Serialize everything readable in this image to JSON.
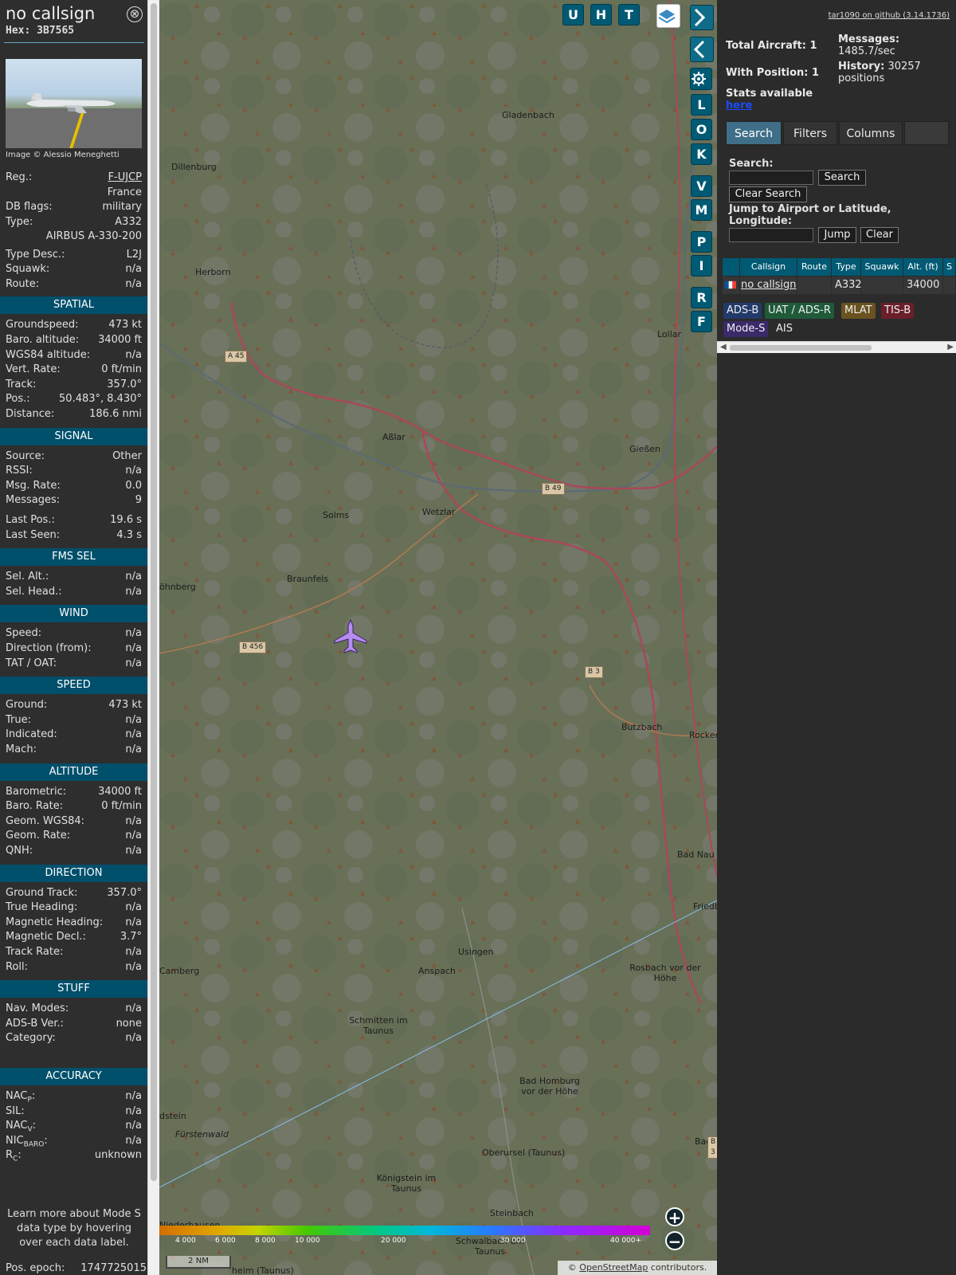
{
  "sidebar": {
    "callsign": "no callsign",
    "hex_label": "Hex:",
    "hex": "3B7565",
    "close_glyph": "⊗",
    "photo_credit": "Image © Alessio Meneghetti",
    "top_rows": [
      {
        "key": "Reg.:",
        "value": "F-UJCP"
      },
      {
        "key": "",
        "value": "France"
      },
      {
        "key": "DB flags:",
        "value": "military"
      },
      {
        "key": "Type:",
        "value": "A332"
      },
      {
        "key": "",
        "value": "AIRBUS A-330-200"
      },
      {
        "key": "Type Desc.:",
        "value": "L2J"
      },
      {
        "key": "Squawk:",
        "value": "n/a"
      },
      {
        "key": "Route:",
        "value": "n/a"
      }
    ],
    "sections": {
      "spatial": {
        "title": "SPATIAL",
        "rows": [
          {
            "key": "Groundspeed:",
            "value": "473 kt"
          },
          {
            "key": "Baro. altitude:",
            "value": "34000 ft"
          },
          {
            "key": "WGS84 altitude:",
            "value": "n/a"
          },
          {
            "key": "Vert. Rate:",
            "value": "0 ft/min"
          },
          {
            "key": "Track:",
            "value": "357.0°"
          },
          {
            "key": "Pos.:",
            "value": "50.483°, 8.430°"
          },
          {
            "key": "Distance:",
            "value": "186.6 nmi"
          }
        ]
      },
      "signal": {
        "title": "SIGNAL",
        "rows": [
          {
            "key": "Source:",
            "value": "Other"
          },
          {
            "key": "RSSI:",
            "value": "n/a"
          },
          {
            "key": "Msg. Rate:",
            "value": "0.0"
          },
          {
            "key": "Messages:",
            "value": "9"
          },
          {
            "key": "Last Pos.:",
            "value": "19.6 s"
          },
          {
            "key": "Last Seen:",
            "value": "4.3 s"
          }
        ]
      },
      "fms": {
        "title": "FMS SEL",
        "rows": [
          {
            "key": "Sel. Alt.:",
            "value": "n/a"
          },
          {
            "key": "Sel. Head.:",
            "value": "n/a"
          }
        ]
      },
      "wind": {
        "title": "WIND",
        "rows": [
          {
            "key": "Speed:",
            "value": "n/a"
          },
          {
            "key": "Direction (from):",
            "value": "n/a"
          },
          {
            "key": "TAT / OAT:",
            "value": "n/a"
          }
        ]
      },
      "speed": {
        "title": "SPEED",
        "rows": [
          {
            "key": "Ground:",
            "value": "473 kt"
          },
          {
            "key": "True:",
            "value": "n/a"
          },
          {
            "key": "Indicated:",
            "value": "n/a"
          },
          {
            "key": "Mach:",
            "value": "n/a"
          }
        ]
      },
      "altitude": {
        "title": "ALTITUDE",
        "rows": [
          {
            "key": "Barometric:",
            "value": "34000 ft"
          },
          {
            "key": "Baro. Rate:",
            "value": "0 ft/min"
          },
          {
            "key": "Geom. WGS84:",
            "value": "n/a"
          },
          {
            "key": "Geom. Rate:",
            "value": "n/a"
          },
          {
            "key": "QNH:",
            "value": "n/a"
          }
        ]
      },
      "direction": {
        "title": "DIRECTION",
        "rows": [
          {
            "key": "Ground Track:",
            "value": "357.0°"
          },
          {
            "key": "True Heading:",
            "value": "n/a"
          },
          {
            "key": "Magnetic Heading:",
            "value": "n/a"
          },
          {
            "key": "Magnetic Decl.:",
            "value": "3.7°"
          },
          {
            "key": "Track Rate:",
            "value": "n/a"
          },
          {
            "key": "Roll:",
            "value": "n/a"
          }
        ]
      },
      "stuff": {
        "title": "STUFF",
        "rows": [
          {
            "key": "Nav. Modes:",
            "value": "n/a"
          },
          {
            "key": "ADS-B Ver.:",
            "value": "none"
          },
          {
            "key": "Category:",
            "value": "n/a"
          }
        ]
      },
      "accuracy": {
        "title": "ACCURACY",
        "rows": [
          {
            "key": "NAC",
            "sub": "P",
            "value": "n/a"
          },
          {
            "key": "SIL:",
            "sub": "",
            "value": "n/a"
          },
          {
            "key": "NAC",
            "sub": "V",
            "value": "n/a"
          },
          {
            "key": "NIC",
            "sub": "BARO",
            "value": "n/a"
          },
          {
            "key": "R",
            "sub": "C",
            "value": "unknown"
          }
        ]
      }
    },
    "learn_more": "Learn more about Mode S data type by hovering over each data label.",
    "pos_epoch_label": "Pos. epoch:",
    "pos_epoch": "1747725015"
  },
  "map": {
    "toolbar_top": [
      "U",
      "H",
      "T"
    ],
    "side_buttons": [
      "L",
      "O",
      "K",
      "V",
      "M",
      "P",
      "I",
      "R",
      "F"
    ],
    "places": [
      "Gladenbach",
      "Dillenburg",
      "Herborn",
      "Aßlar",
      "Gießen",
      "Solms",
      "Wetzlar",
      "Braunfels",
      "öhnberg",
      "Lollar",
      "Butzbach",
      "Rockenb",
      "Bad Nau",
      "Friedb",
      "Usingen",
      "Camberg",
      "Anspach",
      "Rosbach vor der Höhe",
      "Schmitten im Taunus",
      "Bad Homburg vor der Höhe",
      "dstein",
      "Fürstenwald",
      "Oberursel (Taunus)",
      "Königstein im Taunus",
      "Steinbach",
      "Niederhausen",
      "Schwalbach am Taunus",
      "heim (Taunus)",
      "Bad"
    ],
    "roads": [
      "A 45",
      "B 49",
      "B 456",
      "B 3",
      "B 3"
    ],
    "altitude_legend": [
      "4 000",
      "6 000",
      "8 000",
      "10 000",
      "20 000",
      "30 000",
      "40 000+"
    ],
    "scale": "2 NM",
    "attribution_prefix": "© ",
    "attribution_link": "OpenStreetMap",
    "attribution_suffix": " contributors.",
    "zoom_in": "+",
    "zoom_out": "−",
    "plane_heading_deg": 357,
    "colors": {
      "accent": "#005a74",
      "plane": "#b58cf2",
      "track": "#8ac6ff"
    }
  },
  "panel": {
    "github": "tar1090 on github (3.14.1736)",
    "total_aircraft": "Total Aircraft: 1",
    "with_position": "With Position: 1",
    "stats_available": "Stats available",
    "here": "here",
    "messages_label": "Messages:",
    "messages_rate": "1485.7/sec",
    "history_label": "History:",
    "history_value": "30257",
    "history_unit": "positions",
    "tabs": [
      "Search",
      "Filters",
      "Columns"
    ],
    "search_label": "Search:",
    "search_button": "Search",
    "clear_search": "Clear Search",
    "jump_label": "Jump to Airport or Latitude, Longitude:",
    "jump_button": "Jump",
    "clear_button": "Clear",
    "table": {
      "columns": [
        "Callsign",
        "Route",
        "Type",
        "Squawk",
        "Alt. (ft)",
        "S"
      ],
      "rows": [
        {
          "callsign": "no callsign",
          "route": "",
          "type": "A332",
          "squawk": "",
          "alt": "34000"
        }
      ]
    },
    "sources": [
      "ADS-B",
      "UAT / ADS-R",
      "MLAT",
      "TIS-B",
      "Mode-S",
      "AIS"
    ],
    "source_colors": [
      "#223a6a",
      "#1f5a3a",
      "#6a5320",
      "#6a1f2a",
      "#3b2a6a",
      "#2b2b2b"
    ]
  }
}
